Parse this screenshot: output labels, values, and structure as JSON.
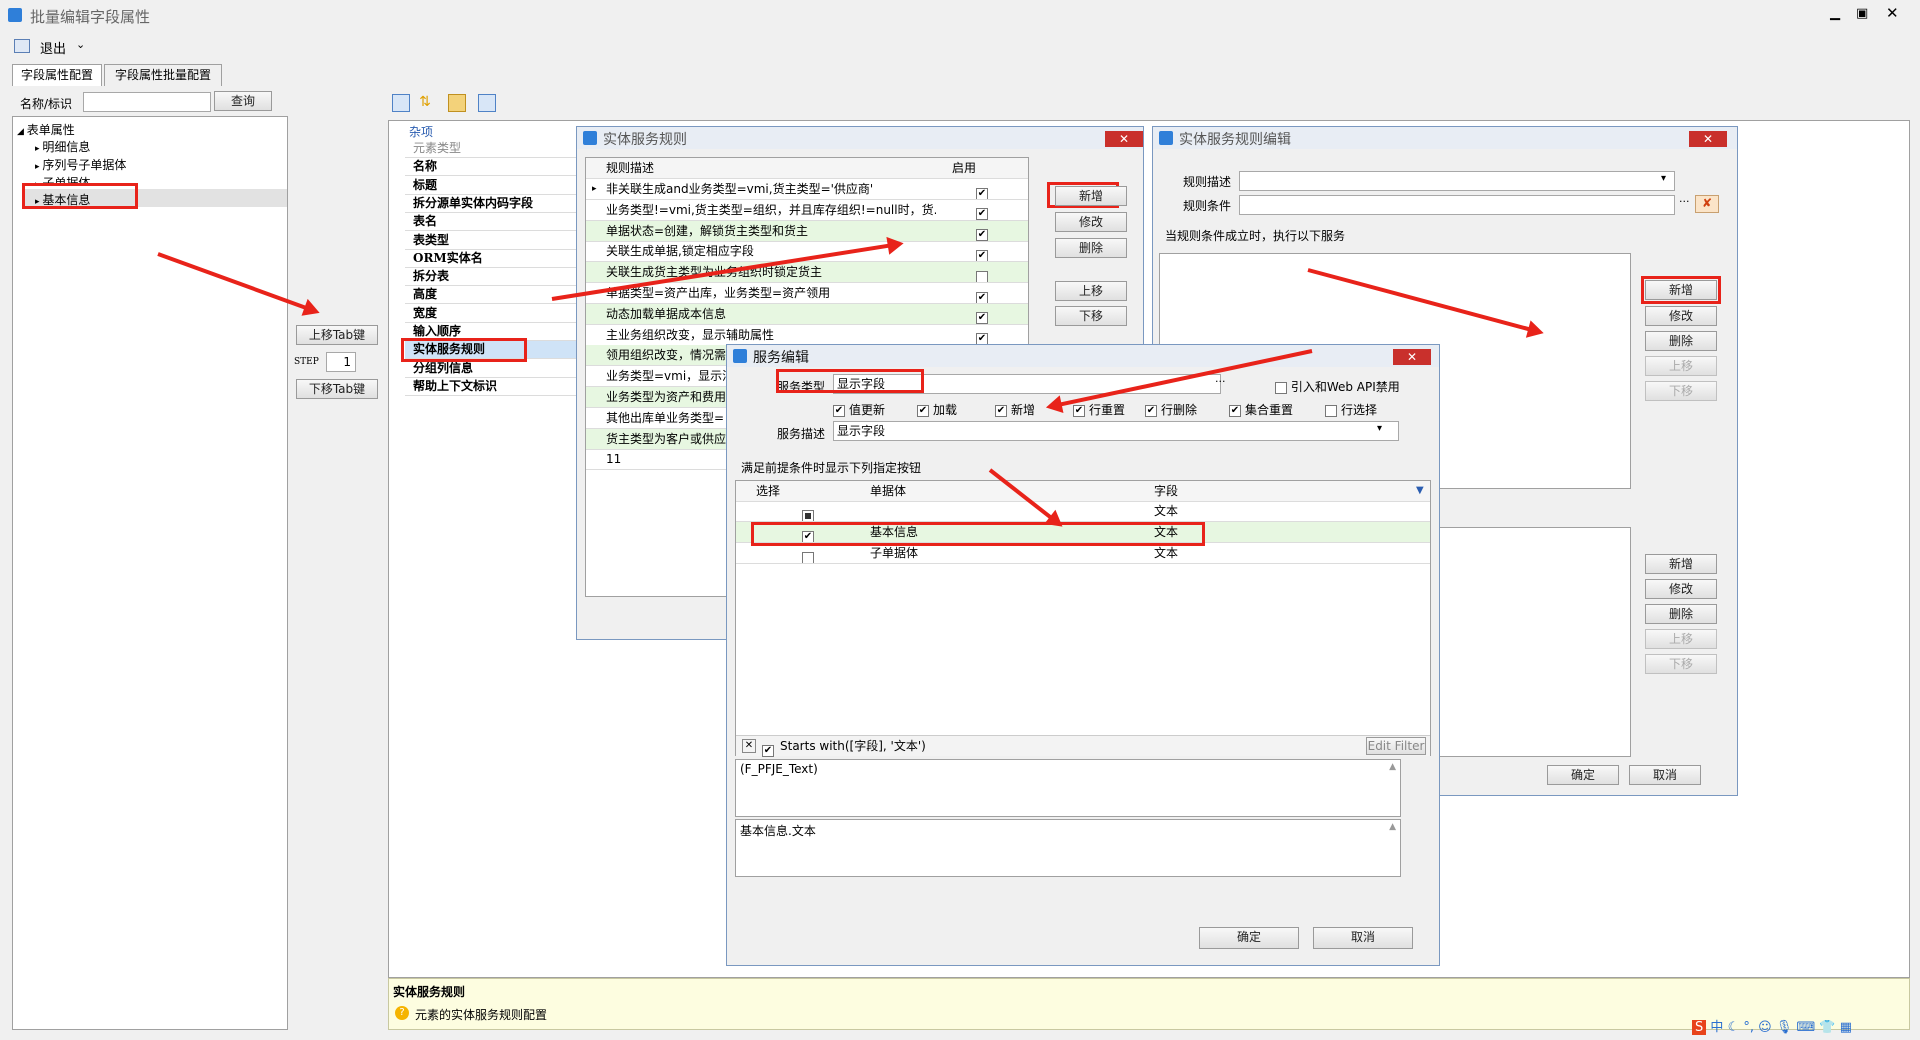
{
  "main_title": "批量编辑字段属性",
  "exit_label": "退出",
  "tabs": [
    "字段属性配置",
    "字段属性批量配置"
  ],
  "name_label": "名称/标识",
  "query_label": "查询",
  "tree": {
    "root": "表单属性",
    "children": [
      "明细信息",
      "序列号子单据体",
      "子单据体",
      "基本信息"
    ]
  },
  "move_up_tab": "上移Tab键",
  "move_down_tab": "下移Tab键",
  "step_label": "STEP",
  "step_value": "1",
  "props_category": "杂项",
  "props": [
    "元素类型",
    "名称",
    "标题",
    "拆分源单实体内码字段",
    "表名",
    "表类型",
    "ORM实体名",
    "拆分表",
    "高度",
    "宽度",
    "输入顺序",
    "实体服务规则",
    "分组列信息",
    "帮助上下文标识"
  ],
  "status": {
    "title": "实体服务规则",
    "desc": "元素的实体服务规则配置"
  },
  "rules_win": {
    "title": "实体服务规则",
    "col_desc": "规则描述",
    "col_enabled": "启用",
    "rows": [
      {
        "text": "非关联生成and业务类型=vmi,货主类型='供应商'",
        "checked": true,
        "green": false
      },
      {
        "text": "业务类型!=vmi,货主类型=组织，并且库存组织!=null时，货...",
        "checked": true,
        "green": false
      },
      {
        "text": "单据状态=创建，解锁货主类型和货主",
        "checked": true,
        "green": true
      },
      {
        "text": "关联生成单据,锁定相应字段",
        "checked": true,
        "green": false
      },
      {
        "text": "关联生成货主类型为业务组织时锁定货主",
        "checked": false,
        "green": true
      },
      {
        "text": "单据类型=资产出库，业务类型=资产领用",
        "checked": true,
        "green": false
      },
      {
        "text": "动态加载单据成本信息",
        "checked": true,
        "green": true
      },
      {
        "text": "主业务组织改变，显示辅助属性",
        "checked": true,
        "green": false
      },
      {
        "text": "领用组织改变，情况需",
        "checked": false,
        "green": true
      },
      {
        "text": "业务类型=vmi，显示消",
        "checked": false,
        "green": false
      },
      {
        "text": "业务类型为资产和费用",
        "checked": false,
        "green": true
      },
      {
        "text": "其他出库单业务类型=",
        "checked": false,
        "green": false
      },
      {
        "text": "货主类型为客户或供应",
        "checked": false,
        "green": true
      },
      {
        "text": "11",
        "checked": false,
        "green": false
      }
    ],
    "buttons": [
      "新增",
      "修改",
      "删除",
      "上移",
      "下移"
    ]
  },
  "edit_win": {
    "title": "实体服务规则编辑",
    "rule_desc": "规则描述",
    "rule_cond": "规则条件",
    "exec_text": "当规则条件成立时，执行以下服务",
    "buttons": [
      "新增",
      "修改",
      "删除",
      "上移",
      "下移"
    ],
    "buttons2": [
      "新增",
      "修改",
      "删除",
      "上移",
      "下移"
    ],
    "ok": "确定",
    "cancel": "取消"
  },
  "service_win": {
    "title": "服务编辑",
    "type_label": "服务类型",
    "type_value": "显示字段",
    "webapi": "引入和Web API禁用",
    "options": [
      {
        "label": "值更新",
        "checked": true
      },
      {
        "label": "加载",
        "checked": true
      },
      {
        "label": "新增",
        "checked": true
      },
      {
        "label": "行重置",
        "checked": true
      },
      {
        "label": "行删除",
        "checked": true
      },
      {
        "label": "集合重置",
        "checked": true
      },
      {
        "label": "行选择",
        "checked": false
      }
    ],
    "desc_label": "服务描述",
    "desc_value": "显示字段",
    "cond_text": "满足前提条件时显示下列指定按钮",
    "cols": [
      "选择",
      "单据体",
      "字段"
    ],
    "rows": [
      {
        "sel": "partial",
        "entity": "",
        "field": "文本"
      },
      {
        "sel": "checked",
        "entity": "基本信息",
        "field": "文本"
      },
      {
        "sel": "unchecked",
        "entity": "子单据体",
        "field": "文本"
      }
    ],
    "filter_text": "Starts with([字段], '文本')",
    "edit_filter": "Edit Filter",
    "text1": "(F_PFJE_Text)",
    "text2": "基本信息.文本",
    "ok": "确定",
    "cancel": "取消"
  }
}
